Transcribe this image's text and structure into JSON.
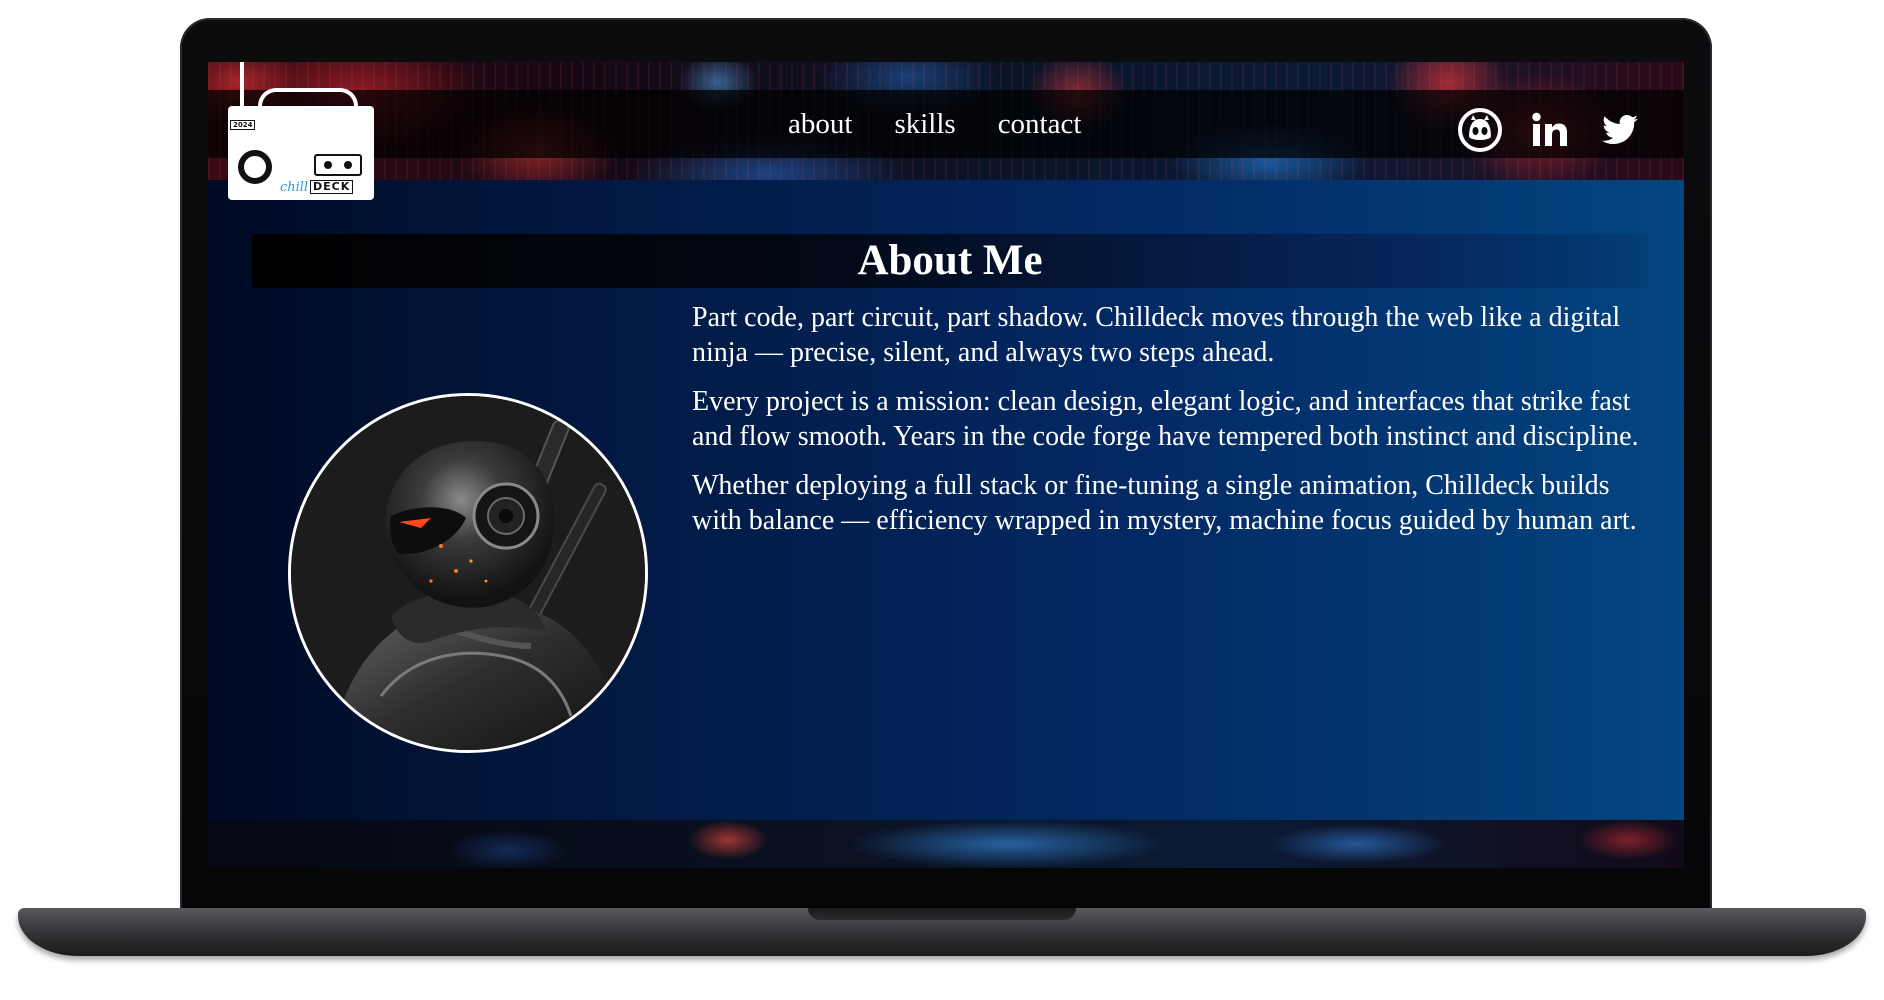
{
  "logo": {
    "year": "2024",
    "brand_script": "chill",
    "brand_block": "DECK"
  },
  "nav": {
    "items": [
      {
        "label": "about"
      },
      {
        "label": "skills"
      },
      {
        "label": "contact"
      }
    ]
  },
  "socials": [
    {
      "icon": "github-icon"
    },
    {
      "icon": "linkedin-icon"
    },
    {
      "icon": "twitter-icon"
    }
  ],
  "about": {
    "heading": "About Me",
    "paragraphs": [
      "Part code, part circuit, part shadow. Chilldeck moves through the web like a digital ninja — precise, silent, and always two steps ahead.",
      "Every project is a mission: clean design, elegant logic, and interfaces that strike fast and flow smooth. Years in the code forge have tempered both instinct and discipline.",
      "Whether deploying a full stack or fine-tuning a single animation, Chilldeck builds with balance — efficiency wrapped in mystery, machine focus guided by human art."
    ]
  },
  "colors": {
    "content_gradient_start": "#000a24",
    "content_gradient_end": "#034580",
    "text": "#ffffff",
    "logo_accent": "#2a9de0"
  }
}
